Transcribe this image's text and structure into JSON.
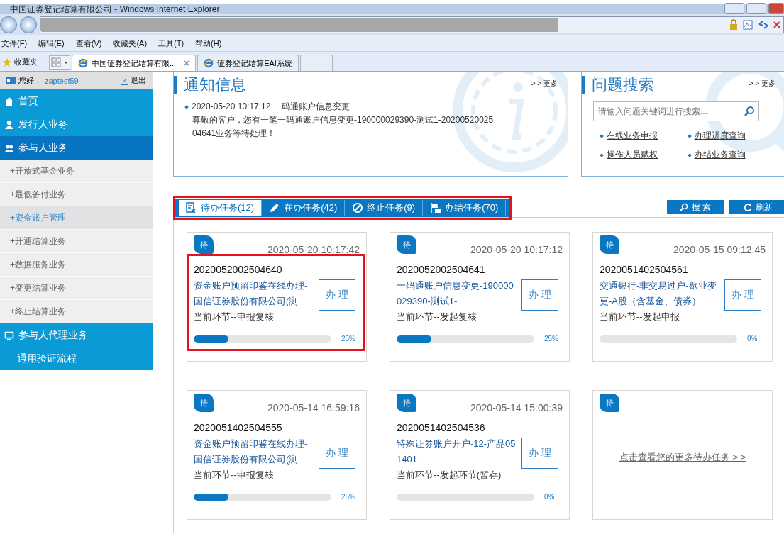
{
  "window": {
    "title": "中国证券登记结算有限公司 - Windows Internet Explorer"
  },
  "menu": [
    "文件(F)",
    "编辑(E)",
    "查看(V)",
    "收藏夹(A)",
    "工具(T)",
    "帮助(H)"
  ],
  "favorites": "收藏夹",
  "browser_tabs": [
    {
      "label": "中国证券登记结算有限...",
      "selected": true
    },
    {
      "label": "证券登记结算EAI系统",
      "selected": false
    }
  ],
  "sidebar": {
    "greeting": "您好，",
    "user": "zaptest59",
    "logout": "退出",
    "items": [
      {
        "label": "首页",
        "kind": "main",
        "selected": false
      },
      {
        "label": "发行人业务",
        "kind": "main",
        "selected": false
      },
      {
        "label": "参与人业务",
        "kind": "main",
        "selected": true
      },
      {
        "label": "+开放式基金业务",
        "kind": "sub",
        "selected": false
      },
      {
        "label": "+最低备付业务",
        "kind": "sub",
        "selected": false
      },
      {
        "label": "+资金账户管理",
        "kind": "sub",
        "selected": true
      },
      {
        "label": "+开通结算业务",
        "kind": "sub",
        "selected": false
      },
      {
        "label": "+数据服务业务",
        "kind": "sub",
        "selected": false
      },
      {
        "label": "+变更结算业务",
        "kind": "sub",
        "selected": false
      },
      {
        "label": "+终止结算业务",
        "kind": "sub",
        "selected": false
      },
      {
        "label": "参与人代理业务",
        "kind": "main",
        "selected": false
      },
      {
        "label": "通用验证流程",
        "kind": "plain",
        "selected": false
      }
    ]
  },
  "notice": {
    "title": "通知信息",
    "more": "> > 更多",
    "items": [
      {
        "headline": "2020-05-20 10:17:12 一码通账户信息变更",
        "body": "尊敬的客户，您有一笔一码通账户信息变更-190000029390-测试1-2020052002504641业务等待处理！"
      }
    ]
  },
  "question": {
    "title": "问题搜索",
    "more": "> > 更多",
    "placeholder": "请输入问题关键词进行搜索...",
    "links": [
      "在线业务申报",
      "办理进度查询",
      "操作人员赋权",
      "办结业务查询"
    ]
  },
  "tasks": {
    "highlighted": true,
    "tabs": [
      {
        "label": "待办任务(12)",
        "selected": true
      },
      {
        "label": "在办任务(42)",
        "selected": false
      },
      {
        "label": "终止任务(9)",
        "selected": false
      },
      {
        "label": "办结任务(70)",
        "selected": false
      }
    ],
    "buttons": [
      "搜 索",
      "刷新"
    ],
    "cards": [
      {
        "kind": "task",
        "badge": "待",
        "time": "2020-05-20 10:17:42",
        "id": "2020052002504640",
        "title": "资金账户预留印鉴在线办理-国信证券股份有限公司(测",
        "step": "当前环节--申报复核",
        "action": "办 理",
        "level": 0.25,
        "percent": "25%",
        "highlighted": true
      },
      {
        "kind": "task",
        "badge": "待",
        "time": "2020-05-20 10:17:12",
        "id": "2020052002504641",
        "title": "一码通账户信息变更-190000029390-测试1-",
        "step": "当前环节--发起复核",
        "action": "办 理",
        "level": 0.25,
        "percent": "25%",
        "highlighted": false
      },
      {
        "kind": "task",
        "badge": "待",
        "time": "2020-05-15 09:12:45",
        "id": "2020051402504561",
        "title": "交通银行-非交易过户-歇业变更-A股（含基金、债券）",
        "step": "当前环节--发起申报",
        "action": "办 理",
        "level": 0,
        "percent": "0%",
        "highlighted": false
      },
      {
        "kind": "task",
        "badge": "待",
        "time": "2020-05-14 16:59:16",
        "id": "2020051402504555",
        "title": "资金账户预留印鉴在线办理-国信证券股份有限公司(测",
        "step": "当前环节--申报复核",
        "action": "办 理",
        "level": 0.25,
        "percent": "25%",
        "highlighted": false
      },
      {
        "kind": "task",
        "badge": "待",
        "time": "2020-05-14 15:00:39",
        "id": "2020051402504536",
        "title": "特殊证券账户开户-12-产品051401-",
        "step": "当前环节--发起环节(暂存)",
        "action": "办 理",
        "level": 0,
        "percent": "0%",
        "highlighted": false
      },
      {
        "kind": "more",
        "badge": "待",
        "link": "点击查看您的更多待办任务 > >"
      }
    ]
  }
}
